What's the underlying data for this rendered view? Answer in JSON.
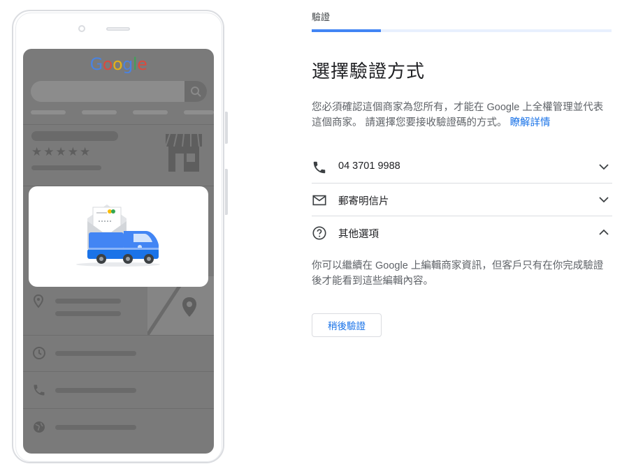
{
  "phone": {
    "logo_letters": [
      "G",
      "o",
      "o",
      "g",
      "l",
      "e"
    ],
    "rating_stars": "★★★★★"
  },
  "colors": {
    "google_blue": "#4285f4",
    "google_red": "#ea4335",
    "google_yellow": "#fbbc05",
    "google_green": "#34a853",
    "link_blue": "#1a73e8",
    "screen_dim": "#7a7a7a"
  },
  "step": {
    "breadcrumb": "驗證",
    "progress_fraction": 0.23
  },
  "page": {
    "title": "選擇驗證方式",
    "description": "您必須確認這個商家為您所有，才能在 Google 上全權管理並代表這個商家。 請選擇您要接收驗證碼的方式。",
    "learn_more": "瞭解詳情"
  },
  "options": [
    {
      "icon": "phone-icon",
      "label": "04 3701 9988",
      "expanded": false
    },
    {
      "icon": "mail-icon",
      "label": "郵寄明信片",
      "expanded": false
    },
    {
      "icon": "help-circle-icon",
      "label": "其他選項",
      "expanded": true
    }
  ],
  "other_option_note": "你可以繼續在 Google 上編輯商家資訊，但客戶只有在你完成驗證後才能看到這些編輯內容。",
  "buttons": {
    "verify_later": "稍後驗證"
  }
}
